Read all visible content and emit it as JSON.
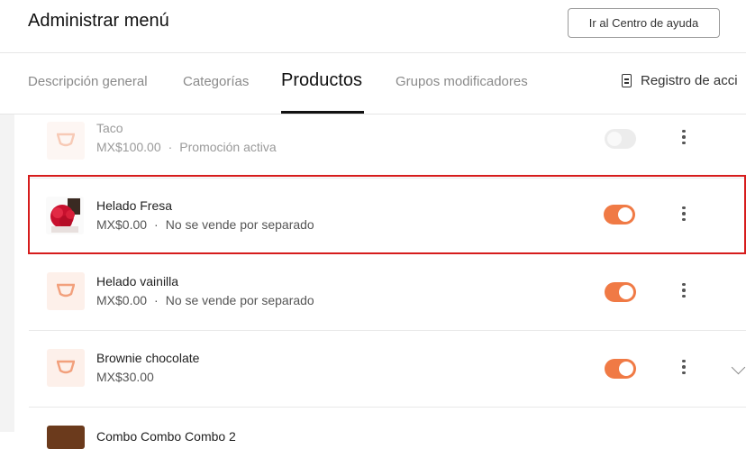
{
  "header": {
    "title": "Administrar menú",
    "help_button": "Ir al Centro de ayuda"
  },
  "tabs": {
    "overview": "Descripción general",
    "categories": "Categorías",
    "products": "Productos",
    "modifier_groups": "Grupos modificadores",
    "activity_log": "Registro de acci"
  },
  "products": [
    {
      "name": "Taco",
      "price": "MX$100.00",
      "note": "Promoción activa",
      "enabled": false
    },
    {
      "name": "Helado Fresa",
      "price": "MX$0.00",
      "note": "No se vende por separado",
      "enabled": true
    },
    {
      "name": "Helado vainilla",
      "price": "MX$0.00",
      "note": "No se vende por separado",
      "enabled": true
    },
    {
      "name": "Brownie chocolate",
      "price": "MX$30.00",
      "note": "",
      "enabled": true
    },
    {
      "name": "Combo Combo Combo 2"
    }
  ],
  "colors": {
    "accent": "#f07a45",
    "selection_border": "#d61c1c"
  }
}
